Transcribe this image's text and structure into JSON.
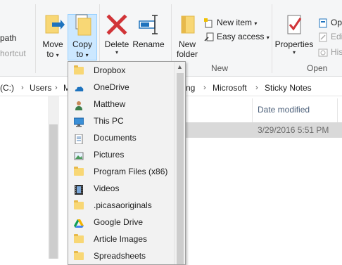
{
  "ribbon": {
    "organize_partial_1": "path",
    "organize_partial_2": "hortcut",
    "move_to": "Move",
    "move_to_2": "to",
    "copy_to": "Copy",
    "copy_to_2": "to",
    "delete": "Delete",
    "rename": "Rename",
    "new_folder": "New",
    "new_folder_2": "folder",
    "new_item": "New item",
    "easy_access": "Easy access",
    "properties": "Properties",
    "open": "Op",
    "edit": "Edi",
    "history": "Hist",
    "group_new": "New",
    "group_open": "Open"
  },
  "address": {
    "drive": "(C:)",
    "users": "Users",
    "partial": "M",
    "partial2": "ng",
    "microsoft": "Microsoft",
    "sticky": "Sticky Notes"
  },
  "list": {
    "col_date": "Date modified",
    "row_date": "3/29/2016 5:51 PM"
  },
  "copy_menu": {
    "items": [
      {
        "label": "Dropbox",
        "icon": "folder-icon"
      },
      {
        "label": "OneDrive",
        "icon": "onedrive-icon"
      },
      {
        "label": "Matthew",
        "icon": "user-icon"
      },
      {
        "label": "This PC",
        "icon": "pc-icon"
      },
      {
        "label": "Documents",
        "icon": "documents-icon"
      },
      {
        "label": "Pictures",
        "icon": "pictures-icon"
      },
      {
        "label": "Program Files (x86)",
        "icon": "folder-icon"
      },
      {
        "label": "Videos",
        "icon": "videos-icon"
      },
      {
        "label": ".picasaoriginals",
        "icon": "folder-icon"
      },
      {
        "label": "Google Drive",
        "icon": "google-drive-icon"
      },
      {
        "label": "Article Images",
        "icon": "folder-icon"
      },
      {
        "label": "Spreadsheets",
        "icon": "folder-icon"
      }
    ]
  },
  "colors": {
    "accent_blue": "#1e73be",
    "delete_red": "#d13438",
    "folder_yellow": "#f8d775",
    "selection": "#cce8ff"
  }
}
